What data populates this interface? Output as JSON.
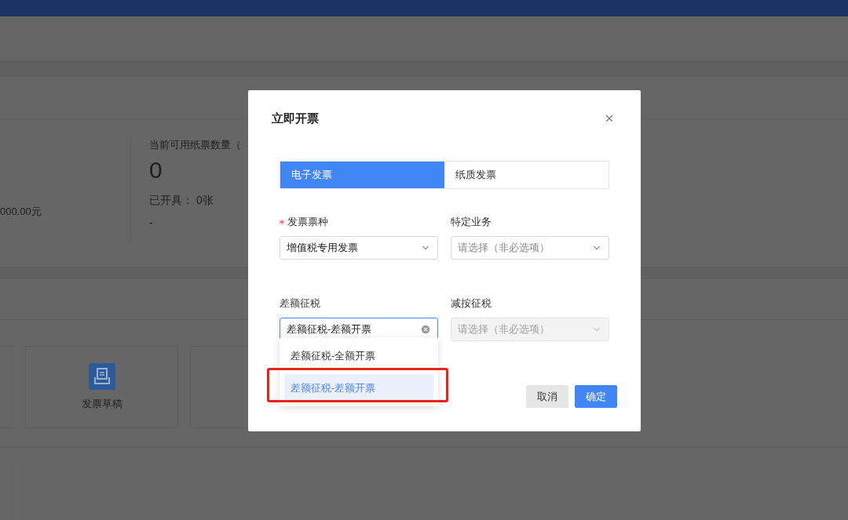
{
  "page": {
    "stats": [
      {
        "kind": "amount",
        "amount": "000.00元"
      },
      {
        "kind": "count",
        "label": "当前可用纸票数量（",
        "value": "0",
        "issued": "已开具： 0张",
        "note": "-"
      }
    ],
    "tiles": [
      {
        "kind": "blank"
      },
      {
        "kind": "labeled",
        "label": "发票草稿"
      },
      {
        "kind": "blank"
      }
    ]
  },
  "dialog": {
    "title": "立即开票",
    "tabs": [
      {
        "label": "电子发票",
        "selected": true
      },
      {
        "label": "纸质发票",
        "selected": false
      }
    ],
    "fields": [
      {
        "label": "发票票种",
        "required": true,
        "value": "增值税专用发票",
        "disabled": false,
        "focused": false
      },
      {
        "label": "特定业务",
        "required": false,
        "placeholder": "请选择（非必选项）",
        "disabled": false,
        "focused": false
      },
      {
        "label": "差额征税",
        "required": false,
        "value": "差额征税-差额开票",
        "disabled": false,
        "focused": true
      },
      {
        "label": "减按征税",
        "required": false,
        "placeholder": "请选择（非必选项）",
        "disabled": true,
        "focused": false
      }
    ],
    "dropdown": {
      "options": [
        {
          "label": "差额征税-全额开票",
          "selected": false,
          "highlighted": false
        },
        {
          "label": "差额征税-差额开票",
          "selected": true,
          "highlighted": true
        }
      ]
    },
    "buttons": [
      {
        "label": "取消",
        "kind": "secondary"
      },
      {
        "label": "确定",
        "kind": "primary"
      }
    ]
  }
}
